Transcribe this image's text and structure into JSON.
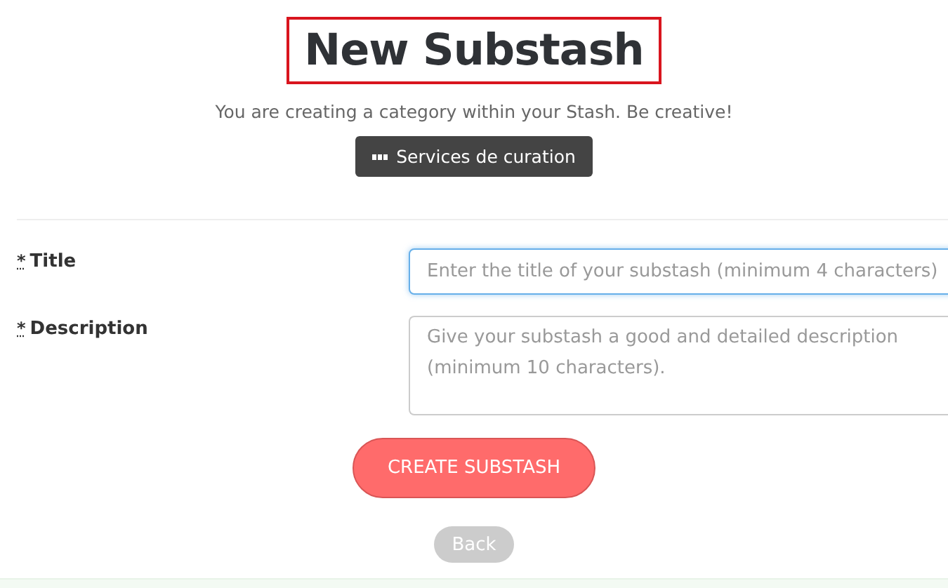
{
  "header": {
    "title": "New Substash",
    "subtitle": "You are creating a category within your Stash. Be creative!",
    "category_button": "Services de curation"
  },
  "form": {
    "fields": [
      {
        "kind": "input",
        "required_mark": "*",
        "label": "Title",
        "placeholder": "Enter the title of your substash (minimum 4 characters)",
        "focused": true
      },
      {
        "kind": "textarea",
        "required_mark": "*",
        "label": "Description",
        "placeholder": "Give your substash a good and detailed description (minimum 10 characters).",
        "focused": false
      }
    ]
  },
  "buttons": {
    "submit": "CREATE SUBSTASH",
    "back": "Back"
  }
}
